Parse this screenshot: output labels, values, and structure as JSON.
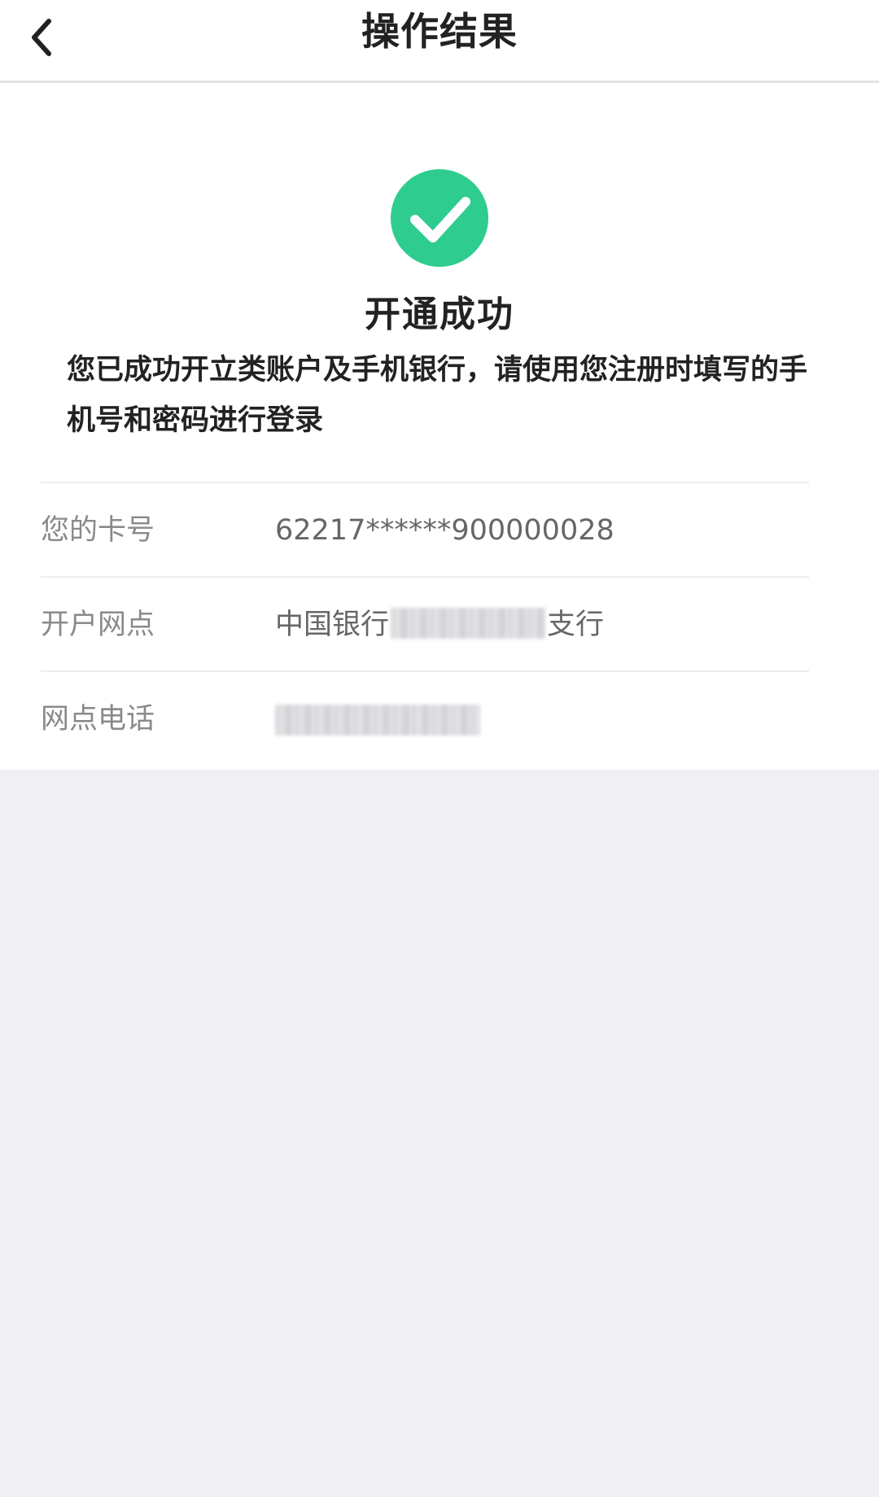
{
  "header": {
    "title": "操作结果",
    "back_icon": "chevron-left-icon"
  },
  "result": {
    "icon": "check-circle-icon",
    "icon_color": "#2ecc8f",
    "title": "开通成功",
    "message": "您已成功开立类账户及手机银行，请使用您注册时填写的手机号和密码进行登录"
  },
  "info": {
    "card_number": {
      "label": "您的卡号",
      "value": "62217******900000028"
    },
    "branch": {
      "label": "开户网点",
      "value_prefix": "中国银行",
      "value_suffix": "支行"
    },
    "phone": {
      "label": "网点电话"
    }
  },
  "colors": {
    "background": "#efeff4",
    "card": "#ffffff",
    "text_primary": "#222222",
    "text_secondary": "#8a8a8a"
  }
}
